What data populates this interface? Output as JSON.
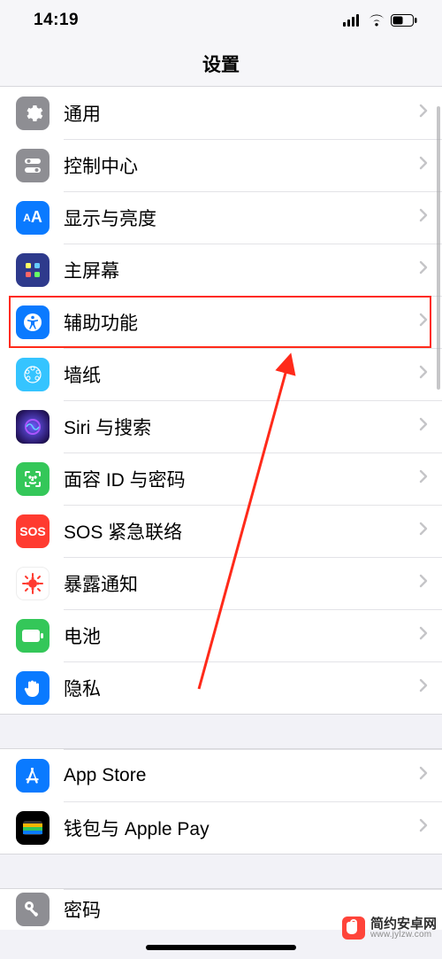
{
  "status": {
    "time": "14:19"
  },
  "nav": {
    "title": "设置"
  },
  "rows": {
    "general": {
      "label": "通用"
    },
    "control": {
      "label": "控制中心"
    },
    "display": {
      "label": "显示与亮度"
    },
    "home": {
      "label": "主屏幕"
    },
    "access": {
      "label": "辅助功能"
    },
    "wallpaper": {
      "label": "墙纸"
    },
    "siri": {
      "label": "Siri 与搜索"
    },
    "faceid": {
      "label": "面容 ID 与密码"
    },
    "sos": {
      "label": "SOS 紧急联络",
      "icon_text": "SOS"
    },
    "exposure": {
      "label": "暴露通知"
    },
    "battery": {
      "label": "电池"
    },
    "privacy": {
      "label": "隐私"
    },
    "appstore": {
      "label": "App Store"
    },
    "wallet": {
      "label": "钱包与 Apple Pay"
    },
    "passwords": {
      "label": "密码"
    }
  },
  "watermark": {
    "brand": "简约安卓网",
    "url": "www.jylzw.com"
  }
}
